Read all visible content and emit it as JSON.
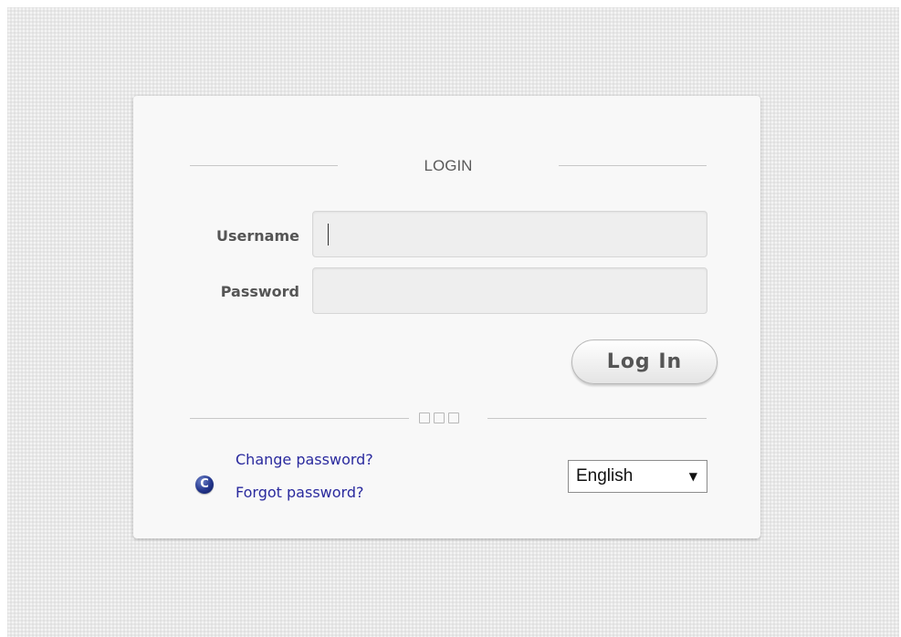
{
  "login": {
    "title": "LOGIN",
    "username_label": "Username",
    "password_label": "Password",
    "username_value": "",
    "password_value": "",
    "submit_label": "Log In"
  },
  "links": {
    "change_password": "Change password?",
    "forgot_password": "Forgot password?"
  },
  "language": {
    "selected": "English",
    "arrow_glyph": "▼"
  },
  "icons": {
    "help_icon_glyph": "C",
    "help_icon_name": "c-logo-icon"
  },
  "colors": {
    "background": "#e8e8e8",
    "card": "#f8f8f8",
    "link": "#2a2a9e",
    "label": "#555555"
  }
}
